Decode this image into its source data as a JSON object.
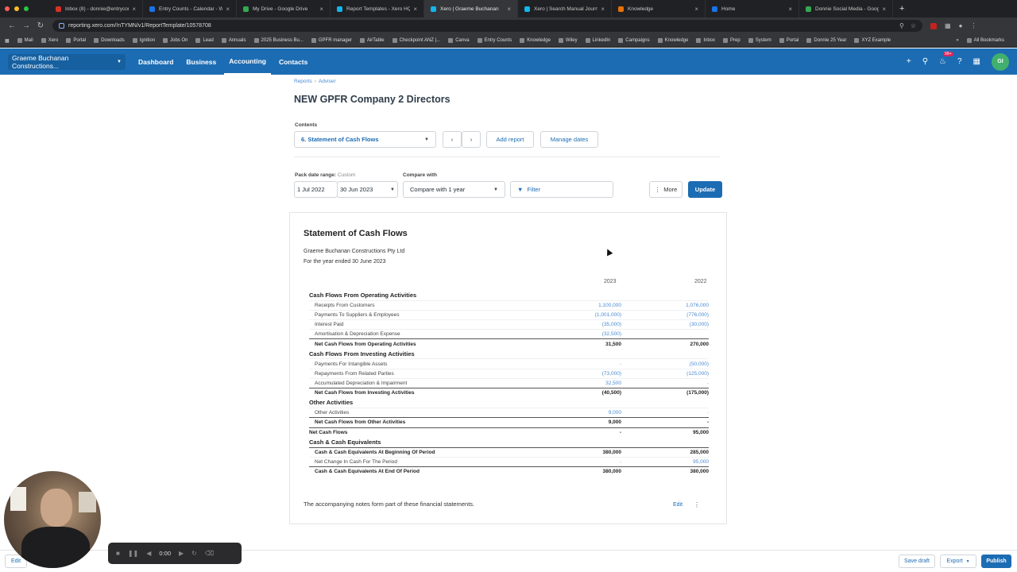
{
  "browser": {
    "tabs": [
      {
        "title": "Inbox (8) - donnie@entrycou",
        "color": "#d93025"
      },
      {
        "title": "Entry Counts - Calendar - We",
        "color": "#1a73e8"
      },
      {
        "title": "My Drive - Google Drive",
        "color": "#34a853"
      },
      {
        "title": "Report Templates - Xero HQ",
        "color": "#13b5ea"
      },
      {
        "title": "Xero | Graeme Buchanan",
        "color": "#13b5ea"
      },
      {
        "title": "Xero | Search Manual Journa",
        "color": "#13b5ea"
      },
      {
        "title": "Knowledge",
        "color": "#e8710a"
      },
      {
        "title": "Home",
        "color": "#1a73e8"
      },
      {
        "title": "Donnie Social Media - Googl",
        "color": "#34a853"
      }
    ],
    "active_tab_index": 4,
    "url": "reporting.xero.com/!nTYMN/v1/ReportTemplate/10578708",
    "bookmarks": [
      "Mail",
      "Xero",
      "Portal",
      "Downloads",
      "Ignition",
      "Jobs On",
      "Lead",
      "Annuals",
      "2025 Business Bu...",
      "GPFR manager",
      "AirTable",
      "Checkpoint ANZ |...",
      "Canva",
      "Entry Counts",
      "Knowledge",
      "Wiley",
      "LinkedIn",
      "Campaigns",
      "Knowledge",
      "Inbox",
      "Prep",
      "System",
      "Portal",
      "Donnie 25 Year",
      "XYZ Example"
    ],
    "all_bookmarks": "All Bookmarks"
  },
  "nav": {
    "org": "Graeme Buchanan Constructions...",
    "links": [
      "Dashboard",
      "Business",
      "Accounting",
      "Contacts"
    ],
    "active_link_index": 2,
    "notification_count": "99+",
    "avatar_initials": "GI"
  },
  "page": {
    "breadcrumb": [
      "Reports",
      "Adviser"
    ],
    "title": "NEW GPFR Company 2 Directors",
    "contents_label": "Contents",
    "contents_value": "6. Statement of Cash Flows",
    "add_report": "Add report",
    "manage_dates": "Manage dates",
    "pack_date_label": "Pack date range:",
    "pack_date_type": "Custom",
    "date_from": "1 Jul 2022",
    "date_to": "30 Jun 2023",
    "compare_label": "Compare with",
    "compare_value": "Compare with 1 year",
    "filter": "Filter",
    "more": "More",
    "update": "Update"
  },
  "report": {
    "title": "Statement of Cash Flows",
    "company": "Graeme Buchanan Constructions Pty Ltd",
    "period": "For the year ended 30 June 2023",
    "columns": [
      "2023",
      "2022"
    ],
    "rows": [
      {
        "type": "section",
        "label": "Cash Flows From Operating Activities",
        "a": "",
        "b": ""
      },
      {
        "type": "item",
        "label": "Receipts From Customers",
        "a": "1,100,000",
        "b": "1,076,000"
      },
      {
        "type": "item",
        "label": "Payments To Suppliers & Employees",
        "a": "(1,001,000)",
        "b": "(776,000)"
      },
      {
        "type": "item",
        "label": "Interest Paid",
        "a": "(35,000)",
        "b": "(30,000)"
      },
      {
        "type": "item",
        "label": "Amortisation & Depreciation Expense",
        "a": "(32,500)",
        "b": ""
      },
      {
        "type": "total",
        "label": "Net Cash Flows from Operating Activities",
        "a": "31,500",
        "b": "270,000"
      },
      {
        "type": "section",
        "label": "Cash Flows From Investing Activities",
        "a": "",
        "b": ""
      },
      {
        "type": "item",
        "label": "Payments For Intangible Assets",
        "a": "-",
        "b": "(50,000)"
      },
      {
        "type": "item",
        "label": "Repayments From Related Parties",
        "a": "(73,000)",
        "b": "(125,000)"
      },
      {
        "type": "item",
        "label": "Accumulated Depreciation & Impairment",
        "a": "32,500",
        "b": "-"
      },
      {
        "type": "total",
        "label": "Net Cash Flows from Investing Activities",
        "a": "(40,500)",
        "b": "(175,000)"
      },
      {
        "type": "section",
        "label": "Other Activities",
        "a": "",
        "b": ""
      },
      {
        "type": "item",
        "label": "Other Activities",
        "a": "9,000",
        "b": "-"
      },
      {
        "type": "total",
        "label": "Net Cash Flows from Other Activities",
        "a": "9,000",
        "b": "-"
      },
      {
        "type": "netcf",
        "label": "Net Cash Flows",
        "a": "-",
        "b": "95,000"
      },
      {
        "type": "section",
        "label": "Cash & Cash Equivalents",
        "a": "",
        "b": ""
      },
      {
        "type": "total",
        "label": "Cash & Cash Equivalents At Beginning Of Period",
        "a": "380,000",
        "b": "285,000"
      },
      {
        "type": "item",
        "label": "Net Change In Cash For The Period",
        "a": "-",
        "b": "95,000"
      },
      {
        "type": "total",
        "label": "Cash & Cash Equivalents At End Of Period",
        "a": "380,000",
        "b": "380,000"
      }
    ],
    "notes": "The accompanying notes form part of these financial statements.",
    "edit": "Edit"
  },
  "footer": {
    "edit": "Edit",
    "save_draft": "Save draft",
    "export": "Export",
    "publish": "Publish"
  },
  "recorder": {
    "time": "0:00"
  },
  "colors": {
    "brand": "#1c6cb3",
    "link": "#4a8bd1"
  }
}
